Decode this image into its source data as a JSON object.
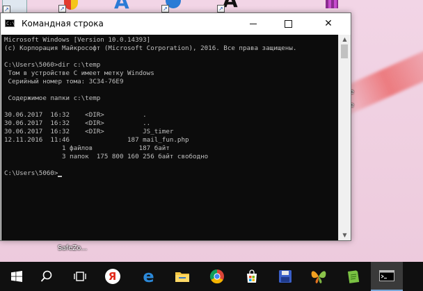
{
  "window": {
    "title": "Командная строка",
    "app_icon_text": "C:\\"
  },
  "console": {
    "lines": [
      "Microsoft Windows [Version 10.0.14393]",
      "(c) Корпорация Майкрософт (Microsoft Corporation), 2016. Все права защищены.",
      "",
      "C:\\Users\\5060>dir c:\\temp",
      " Том в устройстве C имеет метку Windows",
      " Серийный номер тома: 3C34-76E9",
      "",
      " Содержимое папки c:\\temp",
      "",
      "30.06.2017  16:32    <DIR>          .",
      "30.06.2017  16:32    <DIR>          ..",
      "30.06.2017  16:32    <DIR>          JS_timer",
      "12.11.2016  11:46               187 mail_fun.php",
      "               1 файлов            187 байт",
      "               3 папок  175 800 160 256 байт свободно",
      "",
      "C:\\Users\\5060>"
    ]
  },
  "desktop": {
    "shortcut_label": "SafeZo..."
  },
  "taskbar": {
    "items": [
      {
        "name": "windows-start-icon"
      },
      {
        "name": "search-icon"
      },
      {
        "name": "task-view-icon"
      },
      {
        "name": "yandex-browser-icon",
        "glyph": "Я"
      },
      {
        "name": "edge-icon",
        "glyph": "e"
      },
      {
        "name": "file-explorer-icon"
      },
      {
        "name": "chrome-icon"
      },
      {
        "name": "store-icon"
      },
      {
        "name": "save-disk-icon"
      },
      {
        "name": "butterfly-app-icon"
      },
      {
        "name": "notepad-app-icon"
      },
      {
        "name": "command-prompt-icon"
      }
    ]
  },
  "colors": {
    "console_bg": "#0c0c0c",
    "console_fg": "#c0c0c0",
    "taskbar_bg": "#101010"
  }
}
